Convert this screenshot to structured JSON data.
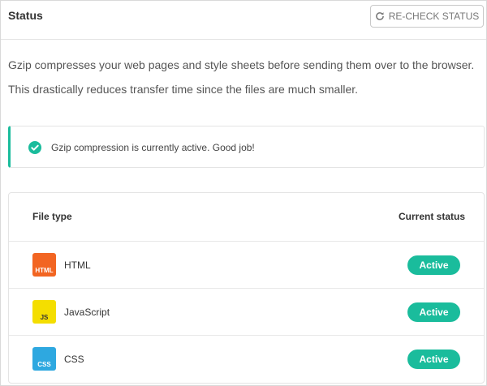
{
  "header": {
    "title": "Status",
    "recheck_label": "RE-CHECK STATUS",
    "recheck_icon": "refresh-icon"
  },
  "description": {
    "line1": "Gzip compresses your web pages and style sheets before sending them over to the browser.",
    "line2": "This drastically reduces transfer time since the files are much smaller."
  },
  "notice": {
    "icon": "check-circle-icon",
    "text": "Gzip compression is currently active. Good job!",
    "accent_color": "#1abc9c"
  },
  "table": {
    "col_file_type": "File type",
    "col_current_status": "Current status",
    "rows": [
      {
        "name": "HTML",
        "icon_label": "HTML",
        "icon_color": "#f26522",
        "icon_text_color": "#ffffff",
        "status": "Active"
      },
      {
        "name": "JavaScript",
        "icon_label": "JS",
        "icon_color": "#f4de00",
        "icon_text_color": "#333333",
        "status": "Active"
      },
      {
        "name": "CSS",
        "icon_label": "CSS",
        "icon_color": "#2ea8e0",
        "icon_text_color": "#ffffff",
        "status": "Active"
      }
    ],
    "status_color": "#1abc9c"
  }
}
